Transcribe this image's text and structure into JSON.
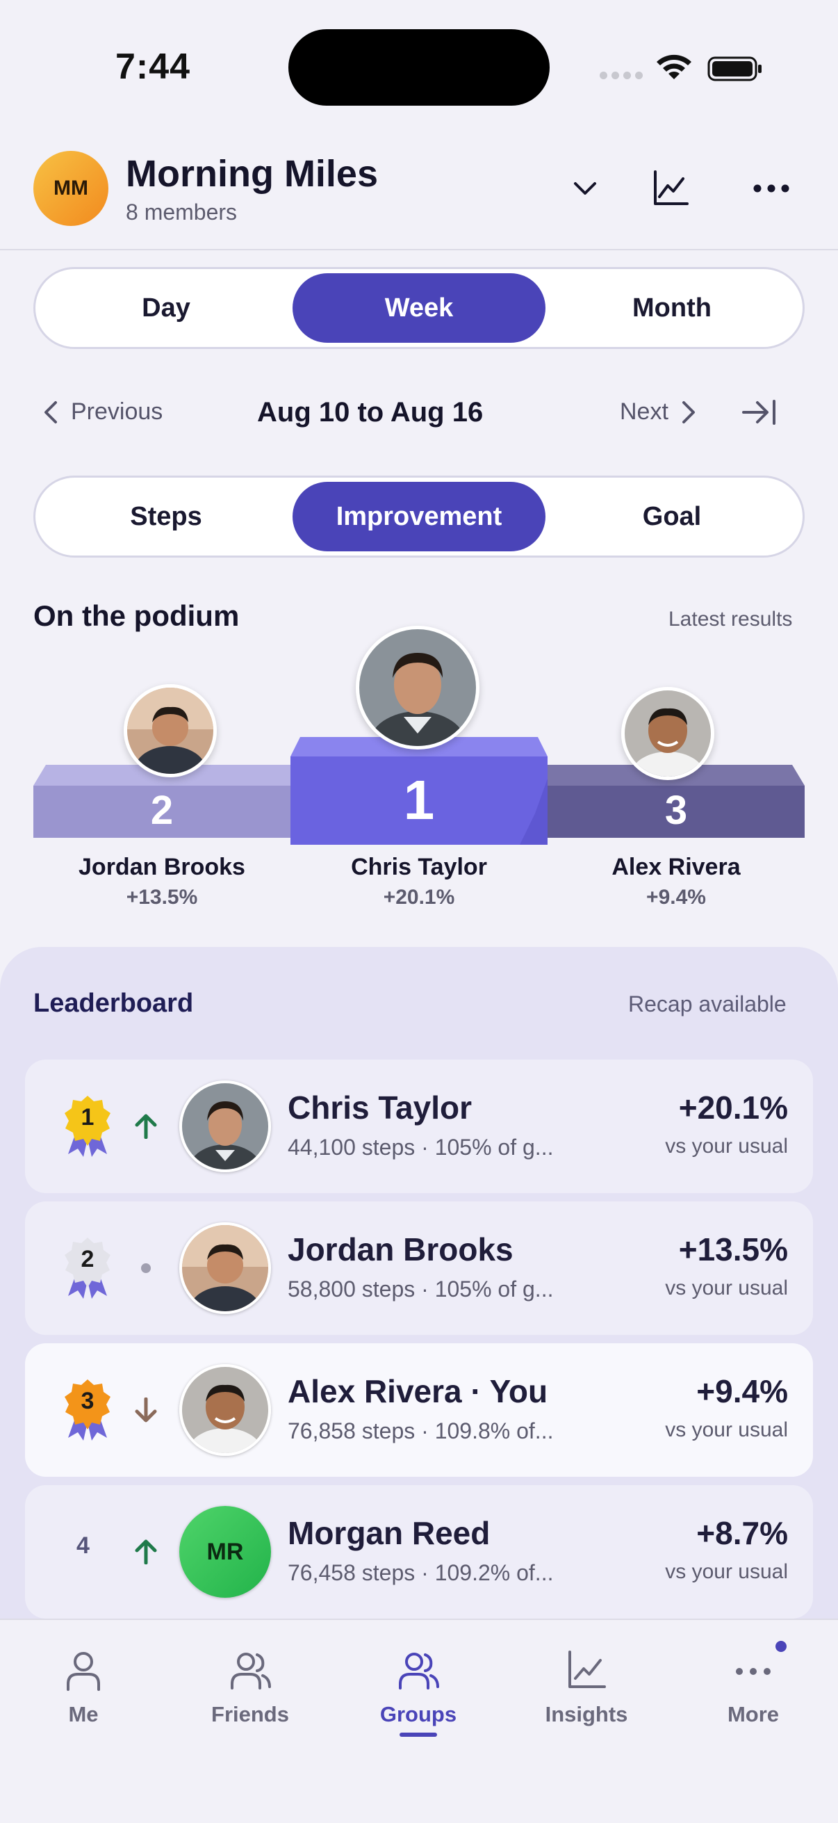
{
  "status_bar": {
    "time": "7:44"
  },
  "header": {
    "avatar_initials": "MM",
    "title": "Morning Miles",
    "members": "8 members",
    "icons": [
      "chevron-down-icon",
      "chart-icon",
      "more-icon"
    ]
  },
  "period_tabs": {
    "items": [
      "Day",
      "Week",
      "Month"
    ],
    "selected": "Week"
  },
  "date_nav": {
    "previous": "Previous",
    "range": "Aug 10 to Aug 16",
    "next": "Next"
  },
  "metric_tabs": {
    "items": [
      "Steps",
      "Improvement",
      "Goal"
    ],
    "selected": "Improvement"
  },
  "podium": {
    "title": "On the podium",
    "subtitle": "Latest results",
    "places": [
      {
        "rank": "2",
        "name": "Jordan Brooks",
        "value": "+13.5%"
      },
      {
        "rank": "1",
        "name": "Chris Taylor",
        "value": "+20.1%"
      },
      {
        "rank": "3",
        "name": "Alex Rivera",
        "value": "+9.4%"
      }
    ]
  },
  "leaderboard": {
    "title": "Leaderboard",
    "subtitle": "Recap available",
    "rows": [
      {
        "rank": "1",
        "trend": "up",
        "name": "Chris Taylor",
        "steps": "44,100 steps · 105% of g...",
        "value": "+20.1%",
        "vs": "vs your usual",
        "initials": ""
      },
      {
        "rank": "2",
        "trend": "same",
        "name": "Jordan Brooks",
        "steps": "58,800 steps · 105% of g...",
        "value": "+13.5%",
        "vs": "vs your usual",
        "initials": ""
      },
      {
        "rank": "3",
        "trend": "down",
        "name": "Alex Rivera · You",
        "steps": "76,858 steps · 109.8% of...",
        "value": "+9.4%",
        "vs": "vs your usual",
        "initials": ""
      },
      {
        "rank": "4",
        "trend": "up",
        "name": "Morgan Reed",
        "steps": "76,458 steps · 109.2% of...",
        "value": "+8.7%",
        "vs": "vs your usual",
        "initials": "MR"
      }
    ]
  },
  "tab_bar": {
    "items": [
      {
        "label": "Me",
        "icon": "person-icon"
      },
      {
        "label": "Friends",
        "icon": "friends-icon"
      },
      {
        "label": "Groups",
        "icon": "groups-icon"
      },
      {
        "label": "Insights",
        "icon": "insights-icon"
      },
      {
        "label": "More",
        "icon": "more-dots-icon"
      }
    ],
    "selected": "Groups"
  },
  "colors": {
    "accent": "#4a44b8",
    "podium_first": "#6a63e0",
    "podium_second": "#9a95cf",
    "podium_third": "#5f5a92",
    "up": "#1f7a4a",
    "down": "#8a6a5a"
  }
}
